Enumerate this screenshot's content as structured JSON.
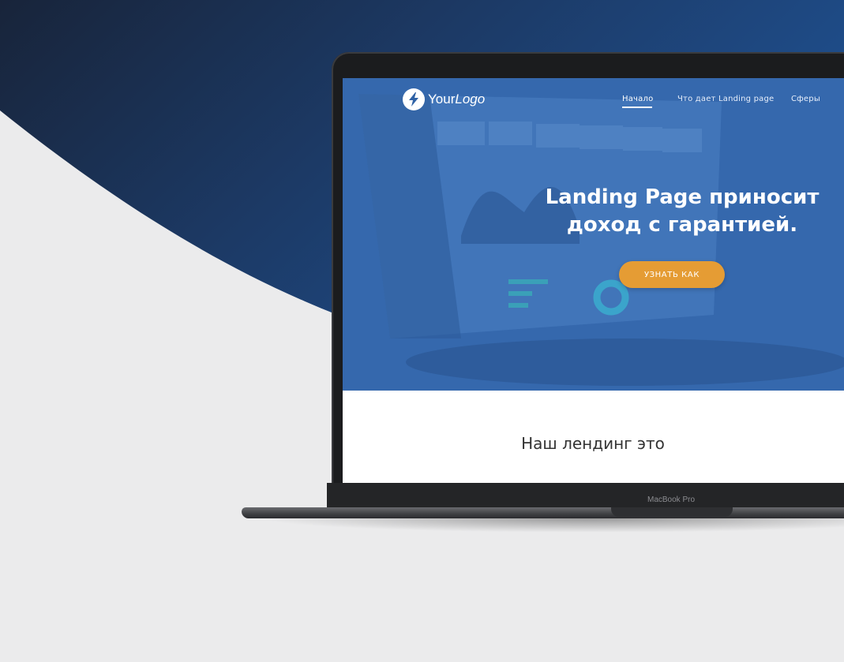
{
  "logo": {
    "part1": "Your",
    "part2": "Logo",
    "icon": "lightning-icon"
  },
  "nav": {
    "items": [
      {
        "label": "Начало"
      },
      {
        "label": "Что дает Landing page"
      },
      {
        "label": "Сферы"
      }
    ]
  },
  "hero": {
    "headline_line1": "Landing Page приносит",
    "headline_line2": "доход с гарантией.",
    "cta_label": "Узнать как"
  },
  "section": {
    "title": "Наш лендинг это"
  },
  "device": {
    "label": "MacBook Pro"
  },
  "colors": {
    "accent": "#e59c34",
    "hero_blue": "#2f62a6",
    "dark_bg": "#1b3558"
  }
}
